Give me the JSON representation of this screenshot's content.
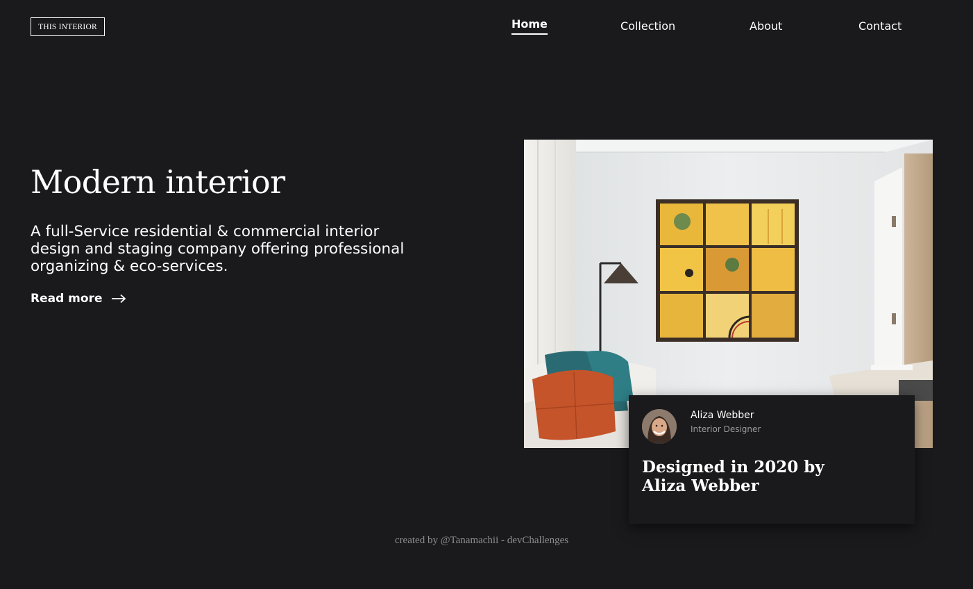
{
  "header": {
    "logo": "THIS INTERIOR",
    "nav": [
      {
        "label": "Home",
        "active": true
      },
      {
        "label": "Collection",
        "active": false
      },
      {
        "label": "About",
        "active": false
      },
      {
        "label": "Contact",
        "active": false
      }
    ]
  },
  "hero": {
    "title": "Modern interior",
    "description": "A full-Service residential & commercial interior design and staging company offering professional organizing & eco-services.",
    "cta": "Read more",
    "cta_icon": "arrow-right-icon",
    "image": "living-room-photo"
  },
  "card": {
    "name": "Aliza Webber",
    "role": "Interior Designer",
    "title": "Designed in 2020 by Aliza Webber",
    "avatar": "avatar-photo"
  },
  "footer": {
    "credit": "created by @Tanamachii - devChallenges"
  },
  "colors": {
    "background": "#1a1a1c",
    "text": "#ffffff",
    "muted": "#9a9a9e",
    "footer": "#8d8d90"
  }
}
